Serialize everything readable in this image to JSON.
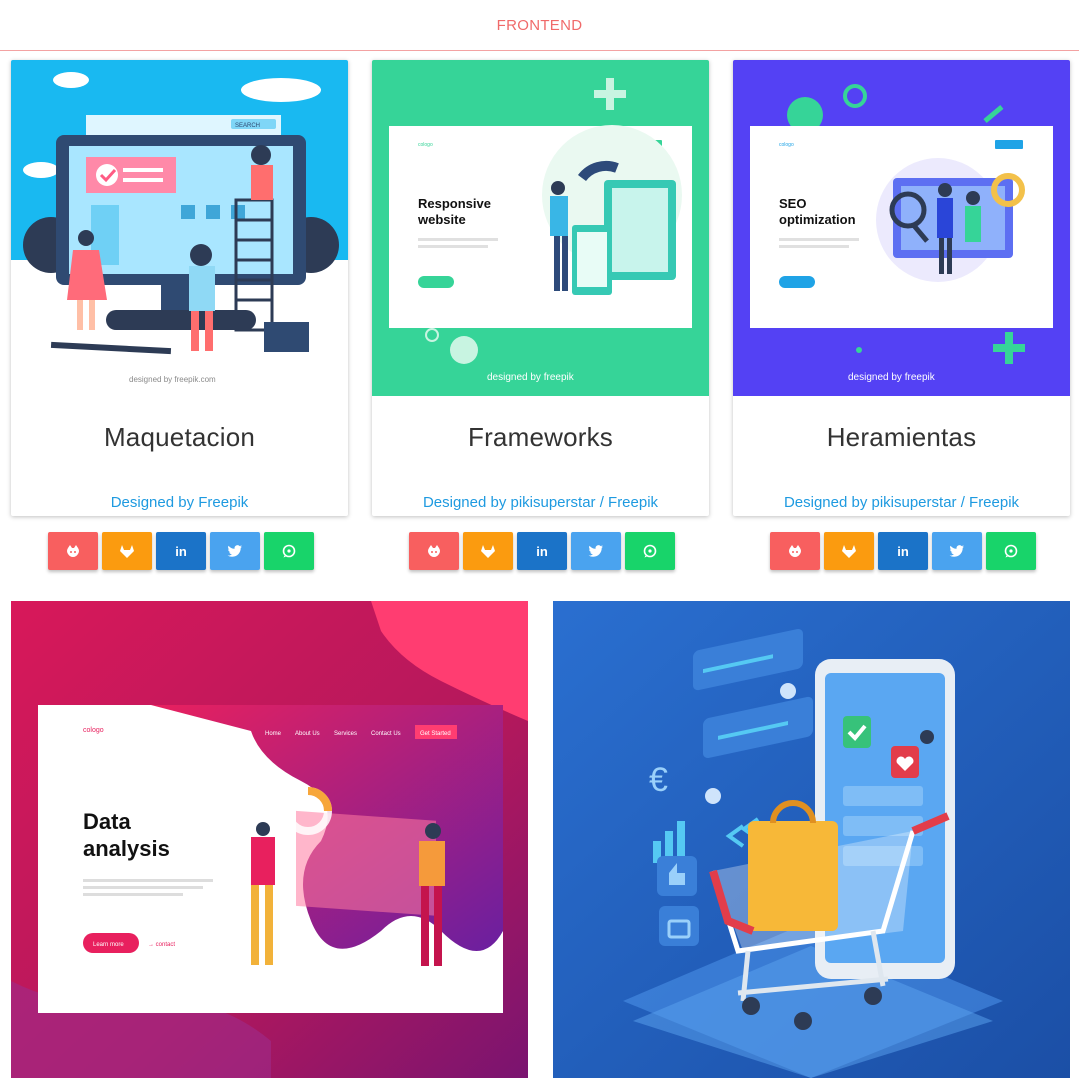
{
  "header": {
    "title": "FRONTEND"
  },
  "cards": [
    {
      "title": "Maquetacion",
      "credit": "Designed by Freepik",
      "image_caption": "designed by freepik.com",
      "search_label": "SEARCH"
    },
    {
      "title": "Frameworks",
      "credit": "Designed by pikisuperstar / Freepik",
      "image_logo": "cologo",
      "image_heading": [
        "Responsive",
        "website"
      ],
      "image_caption": "designed by freepik"
    },
    {
      "title": "Heramientas",
      "credit": "Designed by pikisuperstar / Freepik",
      "image_logo": "cologo",
      "image_heading": [
        "SEO",
        "optimization"
      ],
      "image_caption": "designed by freepik"
    }
  ],
  "share_buttons": [
    {
      "icon": "github-icon",
      "color": "#f85f5f"
    },
    {
      "icon": "gitlab-icon",
      "color": "#fb9b0f"
    },
    {
      "icon": "linkedin-icon",
      "label": "in",
      "color": "#1b73c8"
    },
    {
      "icon": "twitter-icon",
      "color": "#4aa3ef"
    },
    {
      "icon": "whatsapp-icon",
      "color": "#18d46a"
    }
  ],
  "big_cards": [
    {
      "logo": "cologo",
      "nav": [
        "Home",
        "About Us",
        "Services",
        "Contact Us"
      ],
      "cta": "Get Started",
      "heading": [
        "Data",
        "analysis"
      ],
      "button": "Learn more",
      "link": "→ contact"
    },
    {
      "symbol": "€"
    }
  ]
}
